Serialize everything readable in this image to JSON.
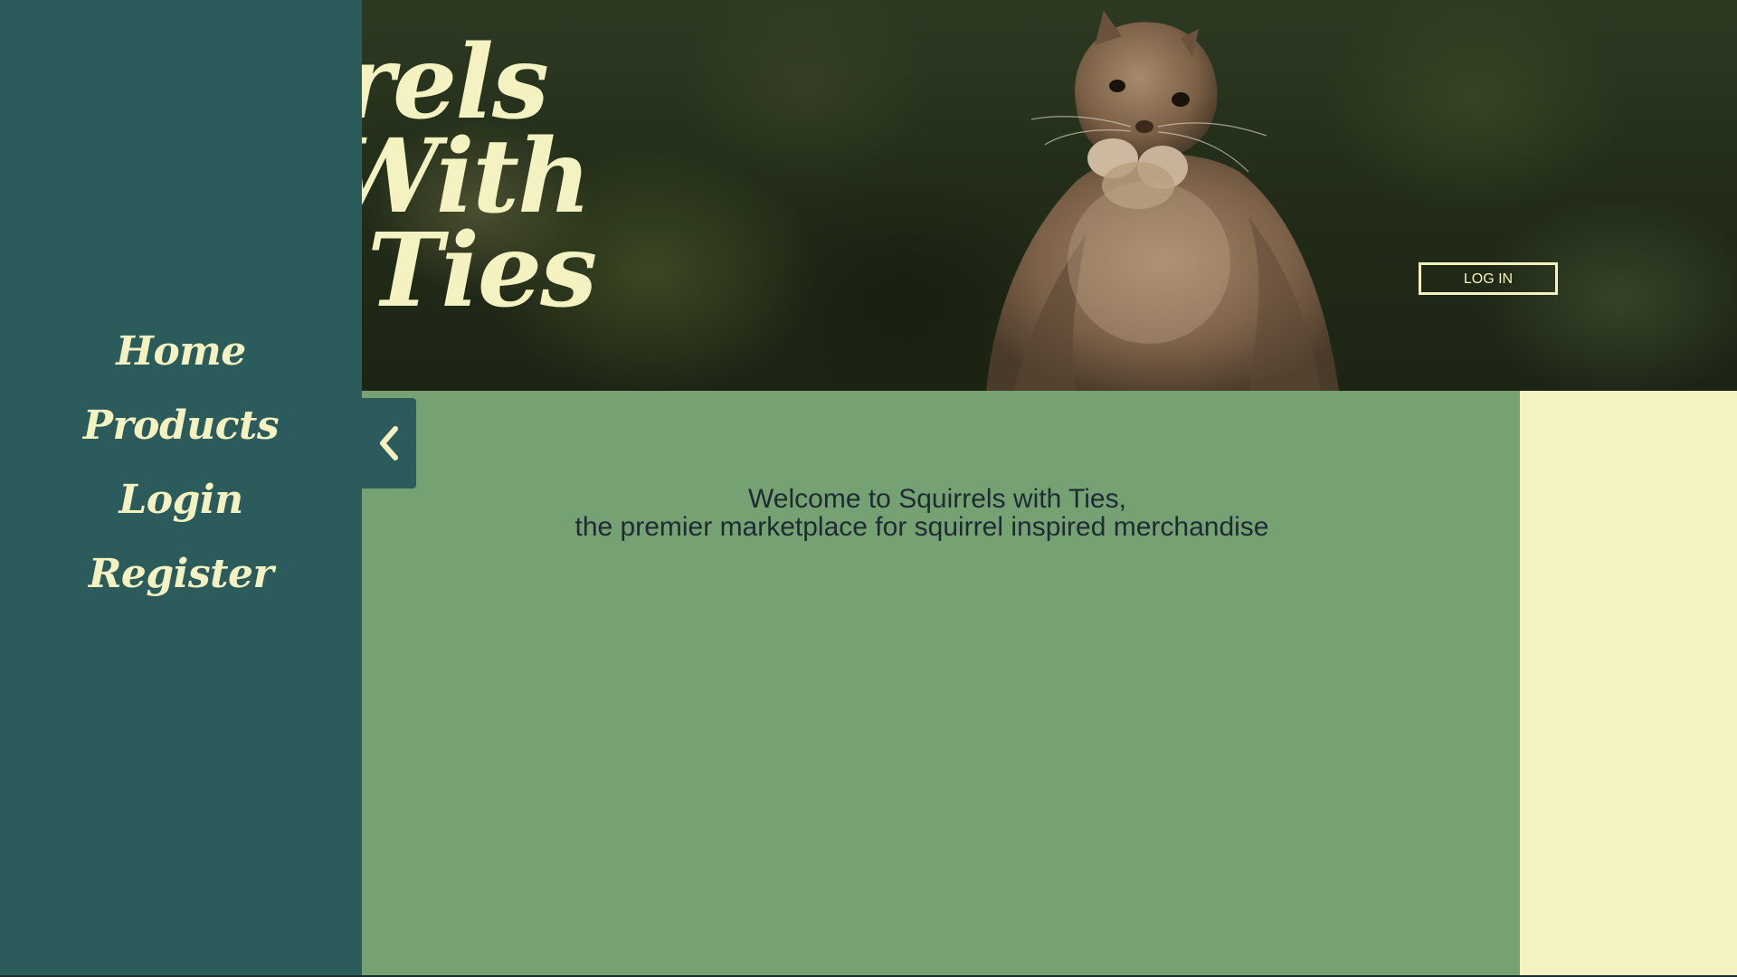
{
  "brand": {
    "title_lines": [
      "rrels",
      "With",
      "Ties"
    ]
  },
  "header": {
    "login_button": "LOG IN"
  },
  "sidebar": {
    "items": [
      {
        "label": "Home"
      },
      {
        "label": "Products"
      },
      {
        "label": "Login"
      },
      {
        "label": "Register"
      }
    ],
    "collapse_icon": "chevron-left-icon"
  },
  "main": {
    "welcome_line1": "Welcome to Squirrels with Ties,",
    "welcome_line2": "the premier marketplace for squirrel inspired merchandise"
  },
  "colors": {
    "sidebar": "#2b5b5a",
    "main": "#75a173",
    "cream": "#f5f2c2",
    "text_dark": "#1e2b33"
  }
}
